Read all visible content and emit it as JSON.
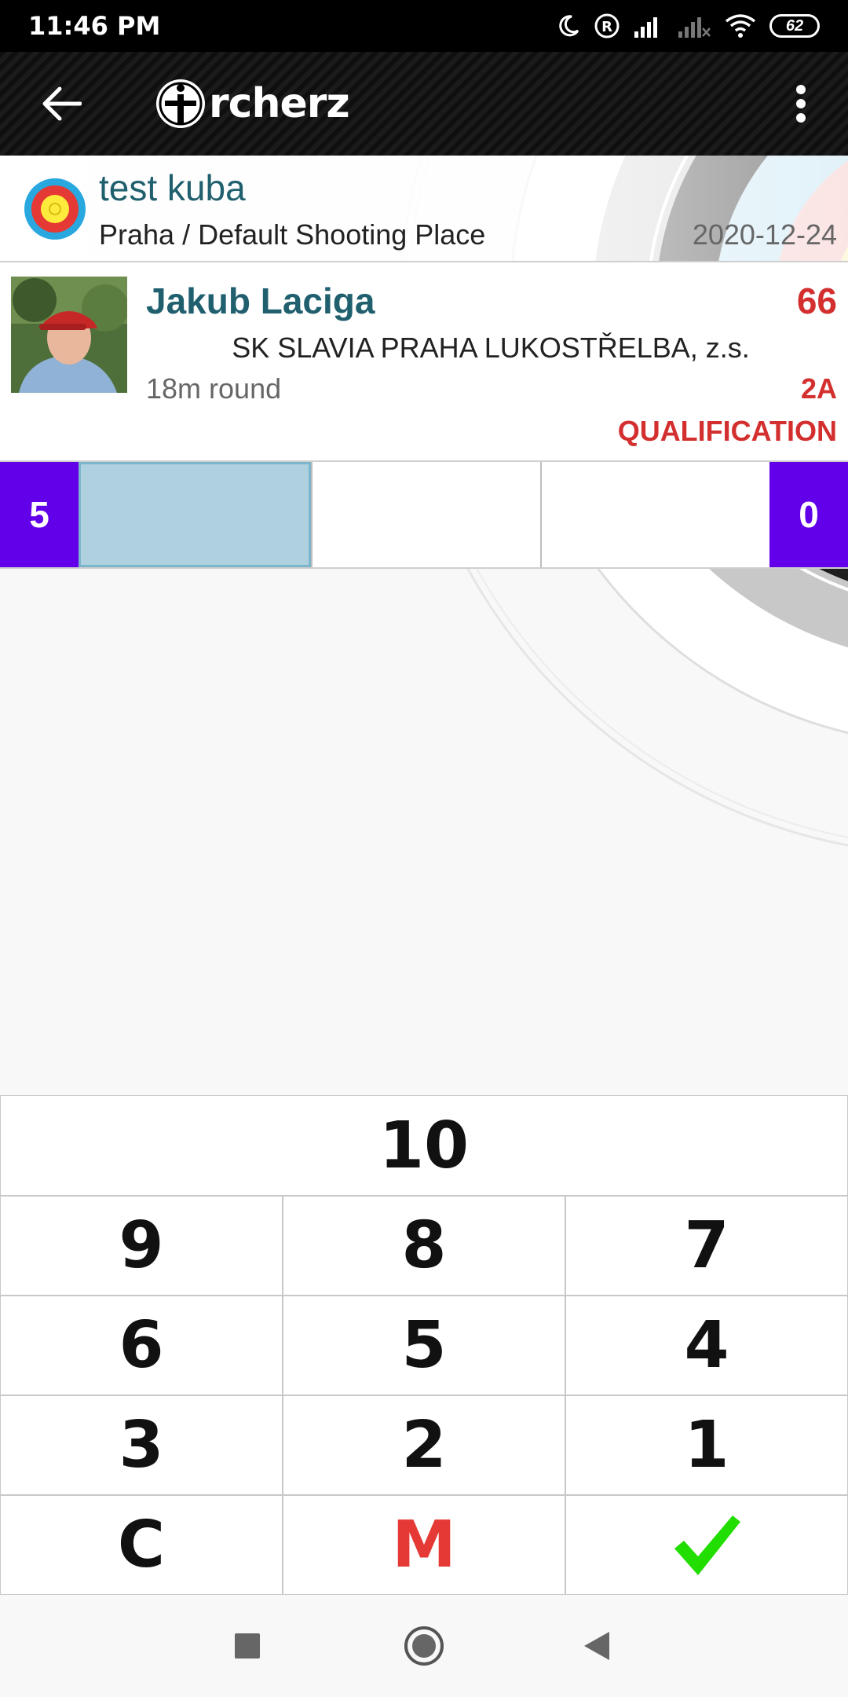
{
  "status_bar": {
    "time": "11:46 PM",
    "battery": "62"
  },
  "app_bar": {
    "logo_text": "rcherz"
  },
  "event": {
    "title": "test kuba",
    "place": "Praha / Default Shooting Place",
    "date": "2020-12-24"
  },
  "archer": {
    "name": "Jakub Laciga",
    "score": "66",
    "club": "SK SLAVIA PRAHA LUKOSTŘELBA, z.s.",
    "round": "18m round",
    "target": "2A",
    "phase": "QUALIFICATION"
  },
  "end": {
    "number": "5",
    "total": "0"
  },
  "keypad": {
    "k10": "10",
    "k9": "9",
    "k8": "8",
    "k7": "7",
    "k6": "6",
    "k5": "5",
    "k4": "4",
    "k3": "3",
    "k2": "2",
    "k1": "1",
    "clear": "C",
    "miss": "M"
  },
  "colors": {
    "accent": "#6200ea",
    "name_teal": "#1f5f6e",
    "score_red": "#d32f2f",
    "active_slot": "#aed0df",
    "confirm_green": "#22dd00"
  }
}
